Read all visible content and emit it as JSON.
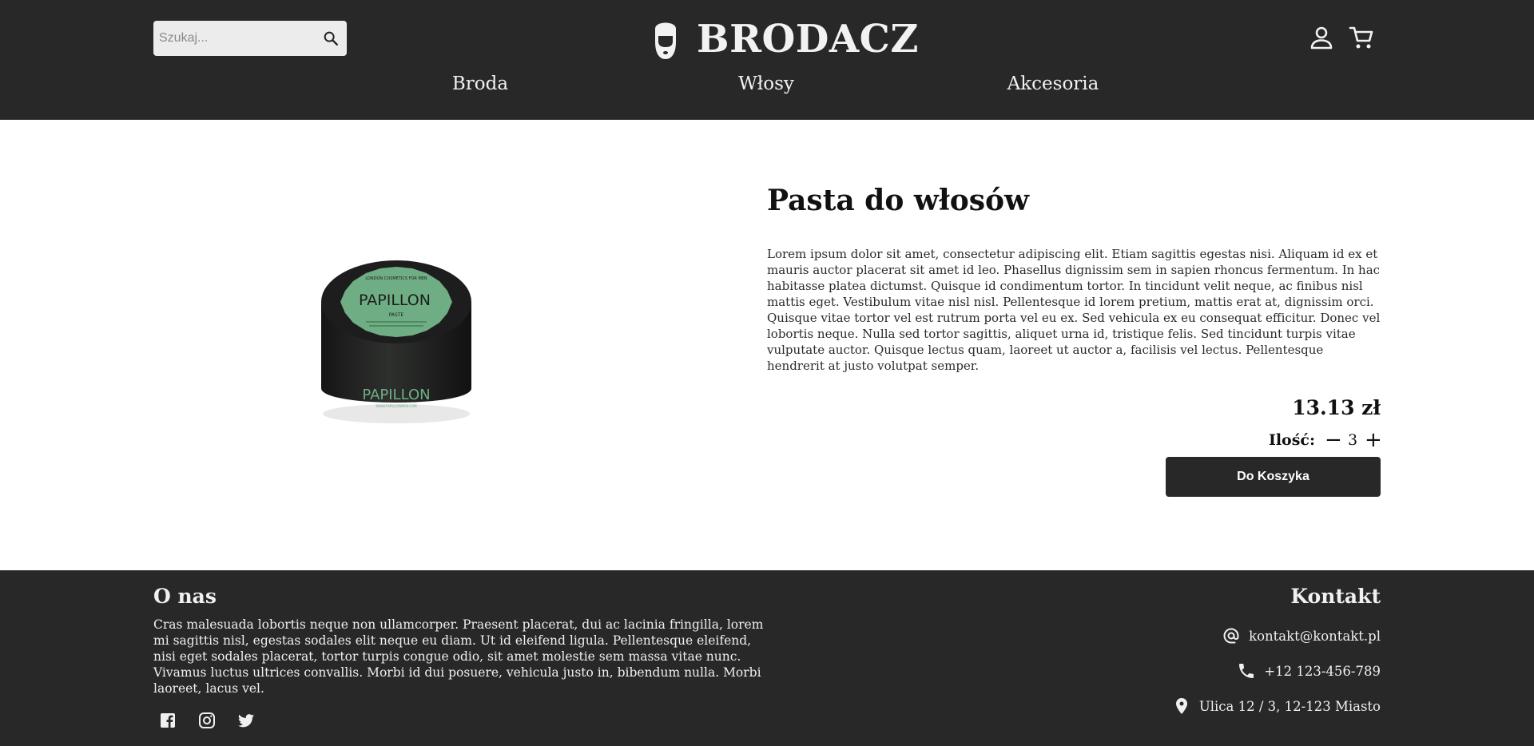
{
  "header": {
    "search_placeholder": "Szukaj...",
    "brand": "BRODACZ",
    "nav": [
      "Broda",
      "Włosy",
      "Akcesoria"
    ]
  },
  "product": {
    "title": "Pasta do włosów",
    "description": "Lorem ipsum dolor sit amet, consectetur adipiscing elit. Etiam sagittis egestas nisi. Aliquam id ex et mauris auctor placerat sit amet id leo. Phasellus dignissim sem in sapien rhoncus fermentum. In hac habitasse platea dictumst. Quisque id condimentum tortor. In tincidunt velit neque, ac finibus nisl mattis eget. Vestibulum vitae nisl nisl. Pellentesque id lorem pretium, mattis erat at, dignissim orci. Quisque vitae tortor vel est rutrum porta vel eu ex. Sed vehicula ex eu consequat efficitur. Donec vel lobortis neque. Nulla sed tortor sagittis, aliquet urna id, tristique felis. Sed tincidunt turpis vitae vulputate auctor. Quisque lectus quam, laoreet ut auctor a, facilisis vel lectus. Pellentesque hendrerit at justo volutpat semper.",
    "price": "13.13 zł",
    "quantity_label": "Ilość:",
    "quantity": "3",
    "decrease_label": "−",
    "increase_label": "+",
    "add_to_cart_label": "Do Koszyka",
    "image": {
      "brand": "PAPILLON",
      "lid_line": "LONDON COSMETICS FOR MEN",
      "product_type": "PASTE",
      "url": "WWW.PAPILLONMEN.COM"
    }
  },
  "footer": {
    "about_title": "O nas",
    "about_text": "Cras malesuada lobortis neque non ullamcorper. Praesent placerat, dui ac lacinia fringilla, lorem mi sagittis nisl, egestas sodales elit neque eu diam. Ut id eleifend ligula. Pellentesque eleifend, nisi eget sodales placerat, tortor turpis congue odio, sit amet molestie sem massa vitae nunc. Vivamus luctus ultrices convallis. Morbi id dui posuere, vehicula justo in, bibendum nulla. Morbi laoreet, lacus vel.",
    "contact_title": "Kontakt",
    "email": "kontakt@kontakt.pl",
    "phone": "+12 123-456-789",
    "address": "Ulica 12 / 3, 12-123 Miasto",
    "social_icons": [
      "facebook-icon",
      "instagram-icon",
      "twitter-icon"
    ]
  },
  "colors": {
    "header_bg": "#282828",
    "footer_bg": "#282828",
    "button_bg": "#282828",
    "search_bg": "#ececec",
    "jar_label": "#6fae85"
  }
}
